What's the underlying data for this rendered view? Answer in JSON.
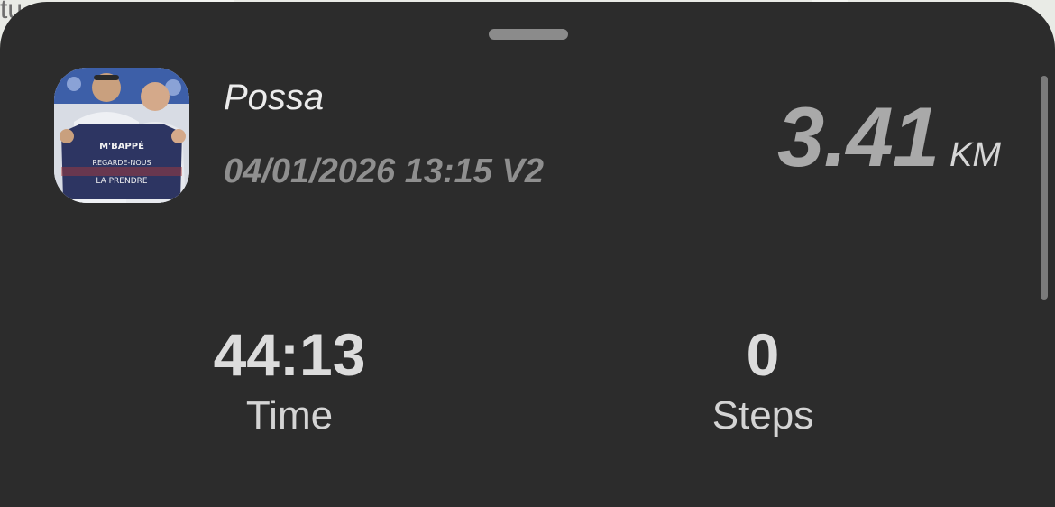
{
  "map": {
    "partial_label": "tu"
  },
  "profile": {
    "username": "Possa",
    "datetime": "04/01/2026 13:15 V2",
    "avatar_shirt_lines": [
      "M'BAPPÉ",
      "REGARDE-NOUS",
      "LA PRENDRE"
    ]
  },
  "distance": {
    "value": "3.41",
    "unit": "KM"
  },
  "stats": {
    "time": {
      "value": "44:13",
      "label": "Time"
    },
    "steps": {
      "value": "0",
      "label": "Steps"
    }
  },
  "colors": {
    "sheet_background": "#2c2c2c",
    "primary_text": "#dcdcdc",
    "muted_text": "#8f8f8f"
  }
}
